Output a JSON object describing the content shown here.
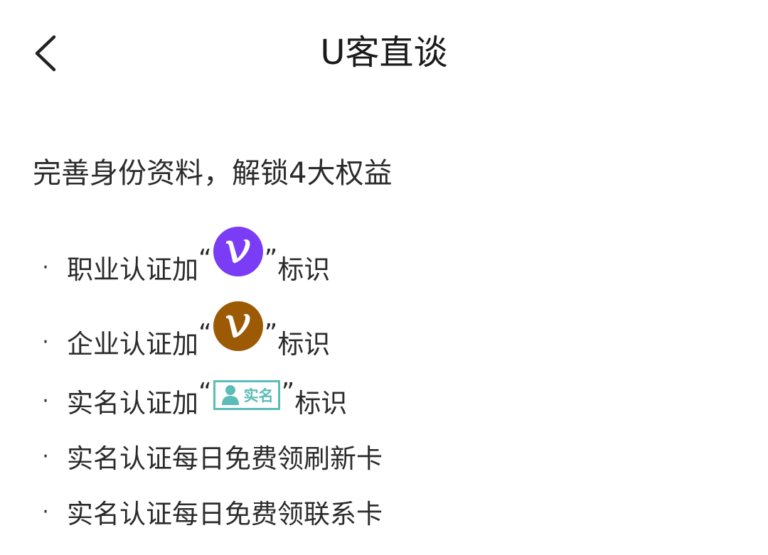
{
  "header": {
    "title": "U客直谈",
    "back_icon": "chevron-left-icon"
  },
  "headline": "完善身份资料，解锁4大权益",
  "colors": {
    "professional_badge": "#7a3cf5",
    "enterprise_badge": "#9c5a05",
    "realname_badge": "#5bbcb8"
  },
  "benefits": [
    {
      "bullet": "·",
      "prefix": "职业认证加",
      "open_quote": "“",
      "close_quote": "”",
      "suffix": "标识",
      "icon": "v-badge-purple-icon"
    },
    {
      "bullet": "·",
      "prefix": "企业认证加",
      "open_quote": "“",
      "close_quote": "”",
      "suffix": "标识",
      "icon": "v-badge-brown-icon"
    },
    {
      "bullet": "·",
      "prefix": "实名认证加",
      "open_quote": "“",
      "close_quote": "”",
      "suffix": "标识",
      "icon": "realname-badge-icon",
      "badge_label": "实名"
    },
    {
      "bullet": "·",
      "text": "实名认证每日免费领刷新卡"
    },
    {
      "bullet": "·",
      "text": "实名认证每日免费领联系卡"
    }
  ]
}
